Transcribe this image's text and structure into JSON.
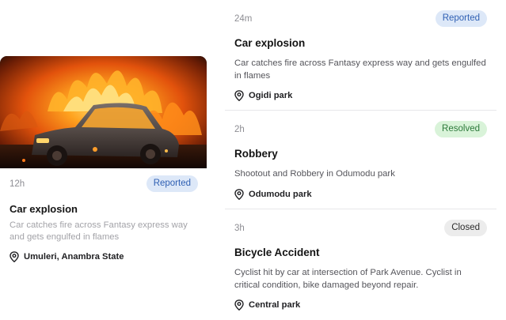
{
  "featured": {
    "time": "12h",
    "status": "Reported",
    "title": "Car explosion",
    "description": "Car catches fire across Fantasy express way and gets engulfed in flames",
    "location": "Umuleri, Anambra State",
    "icon": "location-pin-icon"
  },
  "incidents": [
    {
      "time": "24m",
      "status": "Reported",
      "title": "Car explosion",
      "description": "Car catches fire across Fantasy express way and gets engulfed in flames",
      "location": "Ogidi park",
      "icon": "location-pin-icon"
    },
    {
      "time": "2h",
      "status": "Resolved",
      "title": "Robbery",
      "description": "Shootout and Robbery in Odumodu park",
      "location": "Odumodu park",
      "icon": "location-pin-icon"
    },
    {
      "time": "3h",
      "status": "Closed",
      "title": "Bicycle Accident",
      "description": "Cyclist hit by car at intersection of Park Avenue. Cyclist in critical condition, bike damaged beyond repair.",
      "location": "Central park",
      "icon": "location-pin-icon"
    }
  ],
  "status_colors": {
    "Reported": {
      "bg": "#dde8f8",
      "fg": "#2e5fb3"
    },
    "Resolved": {
      "bg": "#d9f3d9",
      "fg": "#2d7a3b"
    },
    "Closed": {
      "bg": "#ececec",
      "fg": "#2b2b2b"
    }
  }
}
